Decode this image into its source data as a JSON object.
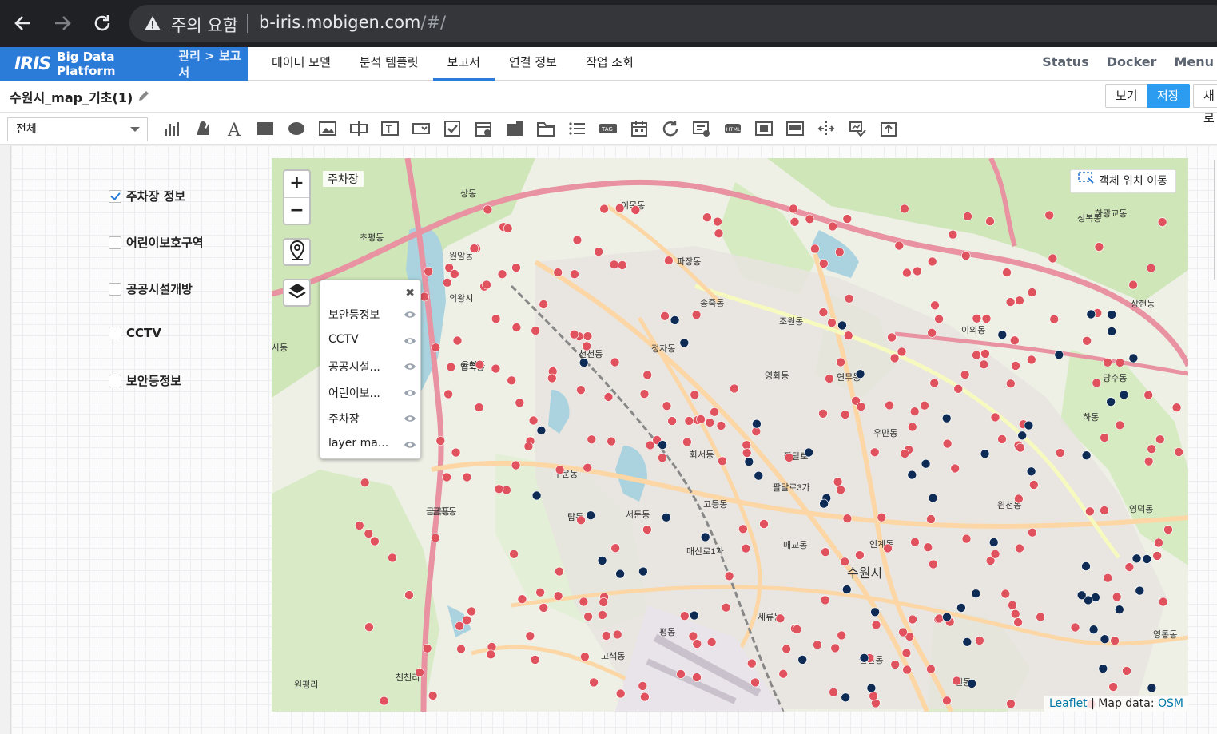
{
  "browser": {
    "security_label": "주의 요함",
    "url_host": "b-iris.mobigen.com",
    "url_path": "/#/"
  },
  "header": {
    "logo": "IRIS",
    "product": "Big Data Platform",
    "breadcrumb": "관리 > 보고서",
    "tabs": [
      {
        "label": "데이터 모델"
      },
      {
        "label": "분석 템플릿"
      },
      {
        "label": "보고서",
        "active": true
      },
      {
        "label": "연결 정보"
      },
      {
        "label": "작업 조회"
      }
    ],
    "right_links": [
      "Status",
      "Docker",
      "Menu"
    ],
    "accent_color": "#2b7bd8"
  },
  "report": {
    "title": "수원시_map_기초(1)",
    "view_label": "보기",
    "save_label": "저장",
    "new_label": "새로"
  },
  "toolbar": {
    "filter_value": "전체",
    "tools": [
      "bar-chart-icon",
      "map-marker-chart-icon",
      "text-icon",
      "rectangle-icon",
      "ellipse-icon",
      "image-icon",
      "input-box-icon",
      "text-box-icon",
      "dropdown-icon",
      "checkbox-icon",
      "date-picker-icon",
      "tabs-icon",
      "folder-tab-icon",
      "list-icon",
      "tag-icon",
      "calendar-icon",
      "refresh-icon",
      "form-icon",
      "html-icon",
      "frame-icon",
      "panel-icon",
      "split-icon",
      "chart-link-icon",
      "export-icon"
    ]
  },
  "filters": [
    {
      "label": "주차장 정보",
      "checked": true
    },
    {
      "label": "어린이보호구역",
      "checked": false
    },
    {
      "label": "공공시설개방",
      "checked": false
    },
    {
      "label": "CCTV",
      "checked": false
    },
    {
      "label": "보안등정보",
      "checked": false
    }
  ],
  "map": {
    "active_layer_label": "주차장",
    "zoom_in": "+",
    "zoom_out": "−",
    "layers": [
      "보안등정보",
      "CCTV",
      "공공시설...",
      "어린이보...",
      "주차장",
      "layer ma..."
    ],
    "move_button": "객체 위치 이동",
    "attribution_leaflet": "Leaflet",
    "attribution_text": " | Map data: ",
    "attribution_osm": "OSM",
    "marker_colors": {
      "parking": "#e0525d",
      "cctv": "#0d2b55"
    },
    "place_labels": [
      "이목동",
      "하광교동",
      "파장동",
      "송죽동",
      "조원동",
      "천천동",
      "정자동",
      "영화동",
      "연무동",
      "이의동",
      "율천동",
      "화서동",
      "우만동",
      "구운동",
      "팔달로",
      "팔달로3가",
      "고등동",
      "탑동",
      "서둔동",
      "매산로1가",
      "매교동",
      "인계동",
      "수원시",
      "원천동",
      "금곡동",
      "세류동",
      "평동",
      "고색동",
      "권선동",
      "신동",
      "영통동",
      "하동",
      "영덕동",
      "원평리",
      "천천리",
      "상현동",
      "성복동",
      "상동",
      "초평동",
      "원암동",
      "입북동",
      "당수동",
      "의왕시",
      "사동",
      "금곡동"
    ]
  }
}
